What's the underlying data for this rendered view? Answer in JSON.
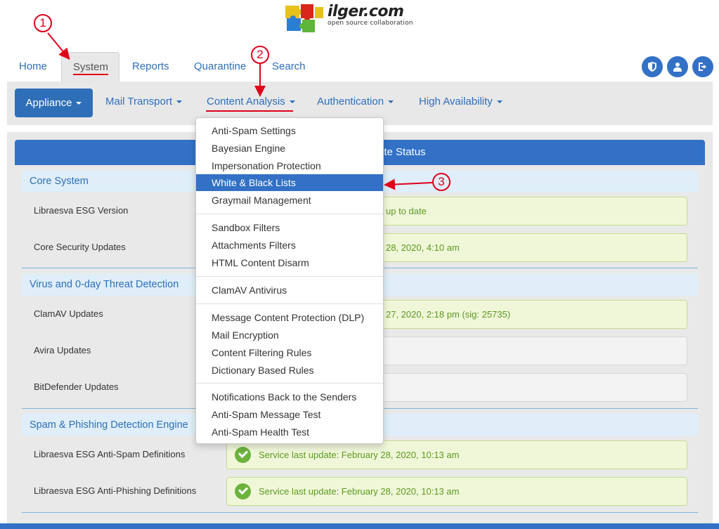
{
  "logo": {
    "wordmark": "ilger.com",
    "tagline": "open source collaboration"
  },
  "topnav": {
    "tabs": [
      {
        "label": "Home",
        "active": false
      },
      {
        "label": "System",
        "active": true
      },
      {
        "label": "Reports",
        "active": false
      },
      {
        "label": "Quarantine",
        "active": false
      },
      {
        "label": "Search",
        "active": false
      }
    ],
    "icons": [
      "shield-icon",
      "user-icon",
      "logout-icon"
    ]
  },
  "subnav": {
    "appliance": "Appliance",
    "items": [
      "Mail Transport",
      "Content Analysis",
      "Authentication",
      "High Availability"
    ]
  },
  "panel": {
    "title_visible": "ate Status",
    "sections": [
      {
        "title": "Core System",
        "rows": [
          {
            "label": "Libraesva ESG Version",
            "status": "up to date",
            "state": "ok"
          },
          {
            "label": "Core Security Updates",
            "status": "28, 2020, 4:10 am",
            "state": "ok"
          }
        ]
      },
      {
        "title": "Virus and 0-day Threat Detection",
        "rows": [
          {
            "label": "ClamAV Updates",
            "status": "27, 2020, 2:18 pm (sig: 25735)",
            "state": "ok"
          },
          {
            "label": "Avira Updates",
            "status": "",
            "state": "empty"
          },
          {
            "label": "BitDefender Updates",
            "status": "",
            "state": "empty"
          }
        ]
      },
      {
        "title": "Spam & Phishing Detection Engine",
        "rows": [
          {
            "label": "Libraesva ESG Anti-Spam Definitions",
            "status": "Service last update: February 28, 2020, 10:13 am",
            "state": "ok"
          },
          {
            "label": "Libraesva ESG Anti-Phishing Definitions",
            "status": "Service last update: February 28, 2020, 10:13 am",
            "state": "ok"
          }
        ]
      }
    ]
  },
  "dropdown": {
    "groups": [
      [
        "Anti-Spam Settings",
        "Bayesian Engine",
        "Impersonation Protection",
        "White & Black Lists",
        "Graymail Management"
      ],
      [
        "Sandbox Filters",
        "Attachments Filters",
        "HTML Content Disarm"
      ],
      [
        "ClamAV Antivirus"
      ],
      [
        "Message Content Protection (DLP)",
        "Mail Encryption",
        "Content Filtering Rules",
        "Dictionary Based Rules"
      ],
      [
        "Notifications Back to the Senders",
        "Anti-Spam Message Test",
        "Anti-Spam Health Test"
      ]
    ],
    "active_item": "White & Black Lists"
  },
  "annotations": [
    "1",
    "2",
    "3"
  ],
  "colors": {
    "accent": "#3271c6",
    "annotation": "#e0001a",
    "ok": "#6cb33e",
    "ok_text": "#5b9a1e"
  }
}
